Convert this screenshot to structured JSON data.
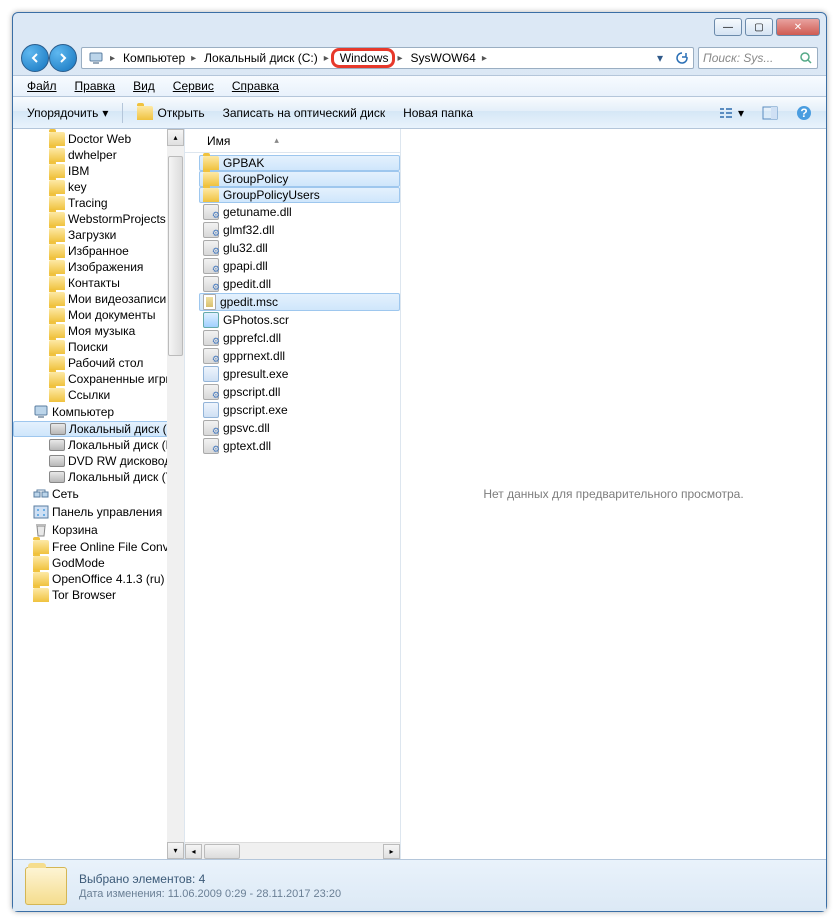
{
  "titlebar": {
    "min": "—",
    "max": "▢",
    "close": "✕"
  },
  "breadcrumb": {
    "root_icon": "computer",
    "segments": [
      "Компьютер",
      "Локальный диск (C:)",
      "Windows",
      "SysWOW64"
    ],
    "highlighted_index": 2
  },
  "search": {
    "placeholder": "Поиск: Sys..."
  },
  "menubar": {
    "file": "Файл",
    "edit": "Правка",
    "view": "Вид",
    "tools": "Сервис",
    "help": "Справка"
  },
  "toolbar": {
    "organize": "Упорядочить",
    "open": "Открыть",
    "burn": "Записать на оптический диск",
    "new_folder": "Новая папка"
  },
  "tree": {
    "items": [
      {
        "label": "Doctor Web",
        "icon": "folder",
        "depth": 1
      },
      {
        "label": "dwhelper",
        "icon": "folder",
        "depth": 1
      },
      {
        "label": "IBM",
        "icon": "folder",
        "depth": 1
      },
      {
        "label": "key",
        "icon": "folder",
        "depth": 1
      },
      {
        "label": "Tracing",
        "icon": "folder",
        "depth": 1
      },
      {
        "label": "WebstormProjects",
        "icon": "folder",
        "depth": 1
      },
      {
        "label": "Загрузки",
        "icon": "folder",
        "depth": 1
      },
      {
        "label": "Избранное",
        "icon": "folder",
        "depth": 1
      },
      {
        "label": "Изображения",
        "icon": "folder",
        "depth": 1
      },
      {
        "label": "Контакты",
        "icon": "folder",
        "depth": 1
      },
      {
        "label": "Мои видеозаписи",
        "icon": "folder",
        "depth": 1
      },
      {
        "label": "Мои документы",
        "icon": "folder",
        "depth": 1
      },
      {
        "label": "Моя музыка",
        "icon": "folder",
        "depth": 1
      },
      {
        "label": "Поиски",
        "icon": "folder",
        "depth": 1
      },
      {
        "label": "Рабочий стол",
        "icon": "folder",
        "depth": 1
      },
      {
        "label": "Сохраненные игры",
        "icon": "folder",
        "depth": 1
      },
      {
        "label": "Ссылки",
        "icon": "folder",
        "depth": 1
      },
      {
        "label": "Компьютер",
        "icon": "pc",
        "depth": 0
      },
      {
        "label": "Локальный диск (C:)",
        "icon": "disk",
        "depth": 1,
        "selected": true
      },
      {
        "label": "Локальный диск (D:)",
        "icon": "disk",
        "depth": 1
      },
      {
        "label": "DVD RW дисковод (",
        "icon": "disk",
        "depth": 1
      },
      {
        "label": "Локальный диск (Y:)",
        "icon": "disk",
        "depth": 1
      },
      {
        "label": "Сеть",
        "icon": "net",
        "depth": 0
      },
      {
        "label": "Панель управления",
        "icon": "cp",
        "depth": 0
      },
      {
        "label": "Корзина",
        "icon": "bin",
        "depth": 0
      },
      {
        "label": "Free Online File Conv",
        "icon": "folder",
        "depth": 0
      },
      {
        "label": "GodMode",
        "icon": "folder",
        "depth": 0
      },
      {
        "label": "OpenOffice 4.1.3 (ru)",
        "icon": "folder",
        "depth": 0
      },
      {
        "label": "Tor Browser",
        "icon": "folder",
        "depth": 0
      }
    ]
  },
  "file_list": {
    "column_header": "Имя",
    "items": [
      {
        "name": "GPBAK",
        "icon": "folder",
        "selected": true
      },
      {
        "name": "GroupPolicy",
        "icon": "folder",
        "selected": true
      },
      {
        "name": "GroupPolicyUsers",
        "icon": "folder",
        "selected": true
      },
      {
        "name": "getuname.dll",
        "icon": "dll",
        "selected": false
      },
      {
        "name": "glmf32.dll",
        "icon": "dll",
        "selected": false
      },
      {
        "name": "glu32.dll",
        "icon": "dll",
        "selected": false
      },
      {
        "name": "gpapi.dll",
        "icon": "dll",
        "selected": false
      },
      {
        "name": "gpedit.dll",
        "icon": "dll",
        "selected": false
      },
      {
        "name": "gpedit.msc",
        "icon": "msc",
        "selected": true
      },
      {
        "name": "GPhotos.scr",
        "icon": "scr",
        "selected": false
      },
      {
        "name": "gpprefcl.dll",
        "icon": "dll",
        "selected": false
      },
      {
        "name": "gpprnext.dll",
        "icon": "dll",
        "selected": false
      },
      {
        "name": "gpresult.exe",
        "icon": "exe",
        "selected": false
      },
      {
        "name": "gpscript.dll",
        "icon": "dll",
        "selected": false
      },
      {
        "name": "gpscript.exe",
        "icon": "exe",
        "selected": false
      },
      {
        "name": "gpsvc.dll",
        "icon": "dll",
        "selected": false
      },
      {
        "name": "gptext.dll",
        "icon": "dll",
        "selected": false
      }
    ]
  },
  "preview": {
    "empty_text": "Нет данных для предварительного просмотра."
  },
  "statusbar": {
    "selection": "Выбрано элементов: 4",
    "modified": "Дата изменения: 11.06.2009 0:29 - 28.11.2017 23:20"
  }
}
